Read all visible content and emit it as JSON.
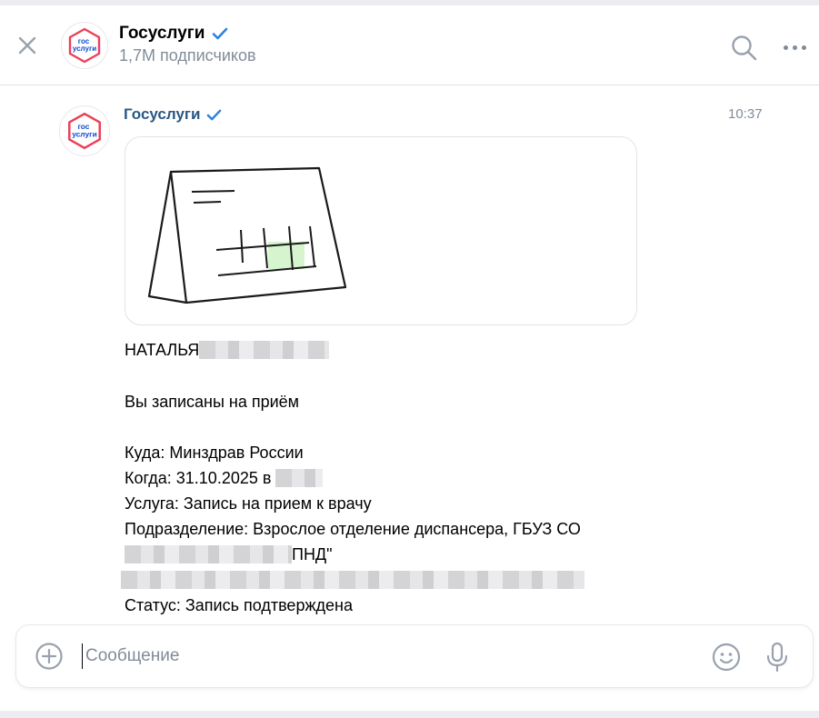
{
  "header": {
    "title": "Госуслуги",
    "subscribers": "1,7M подписчиков"
  },
  "logo": {
    "line1": "гос",
    "line2": "услуги"
  },
  "message": {
    "author": "Госуслуги",
    "time": "10:37",
    "lines": {
      "name": "НАТАЛЬЯ",
      "appointment": "Вы записаны на приём",
      "where": "Куда: Минздрав России",
      "when": "Когда: 31.10.2025 в ",
      "service": "Услуга: Запись на прием к врачу",
      "department": "Подразделение: Взрослое отделение диспансера, ГБУЗ СО",
      "department_cont": "ПНД\"",
      "status": "Статус: Запись подтверждена"
    }
  },
  "composer": {
    "placeholder": "Сообщение"
  },
  "colors": {
    "verified": "#2d81e0",
    "author": "#2a5885",
    "secondary": "#818c99",
    "logo_red": "#ee3f58",
    "logo_blue": "#0d4cd3"
  },
  "icons": [
    "close-icon",
    "verified-icon",
    "search-icon",
    "more-icon",
    "calendar-illustration",
    "add-icon",
    "emoji-icon",
    "mic-icon"
  ]
}
